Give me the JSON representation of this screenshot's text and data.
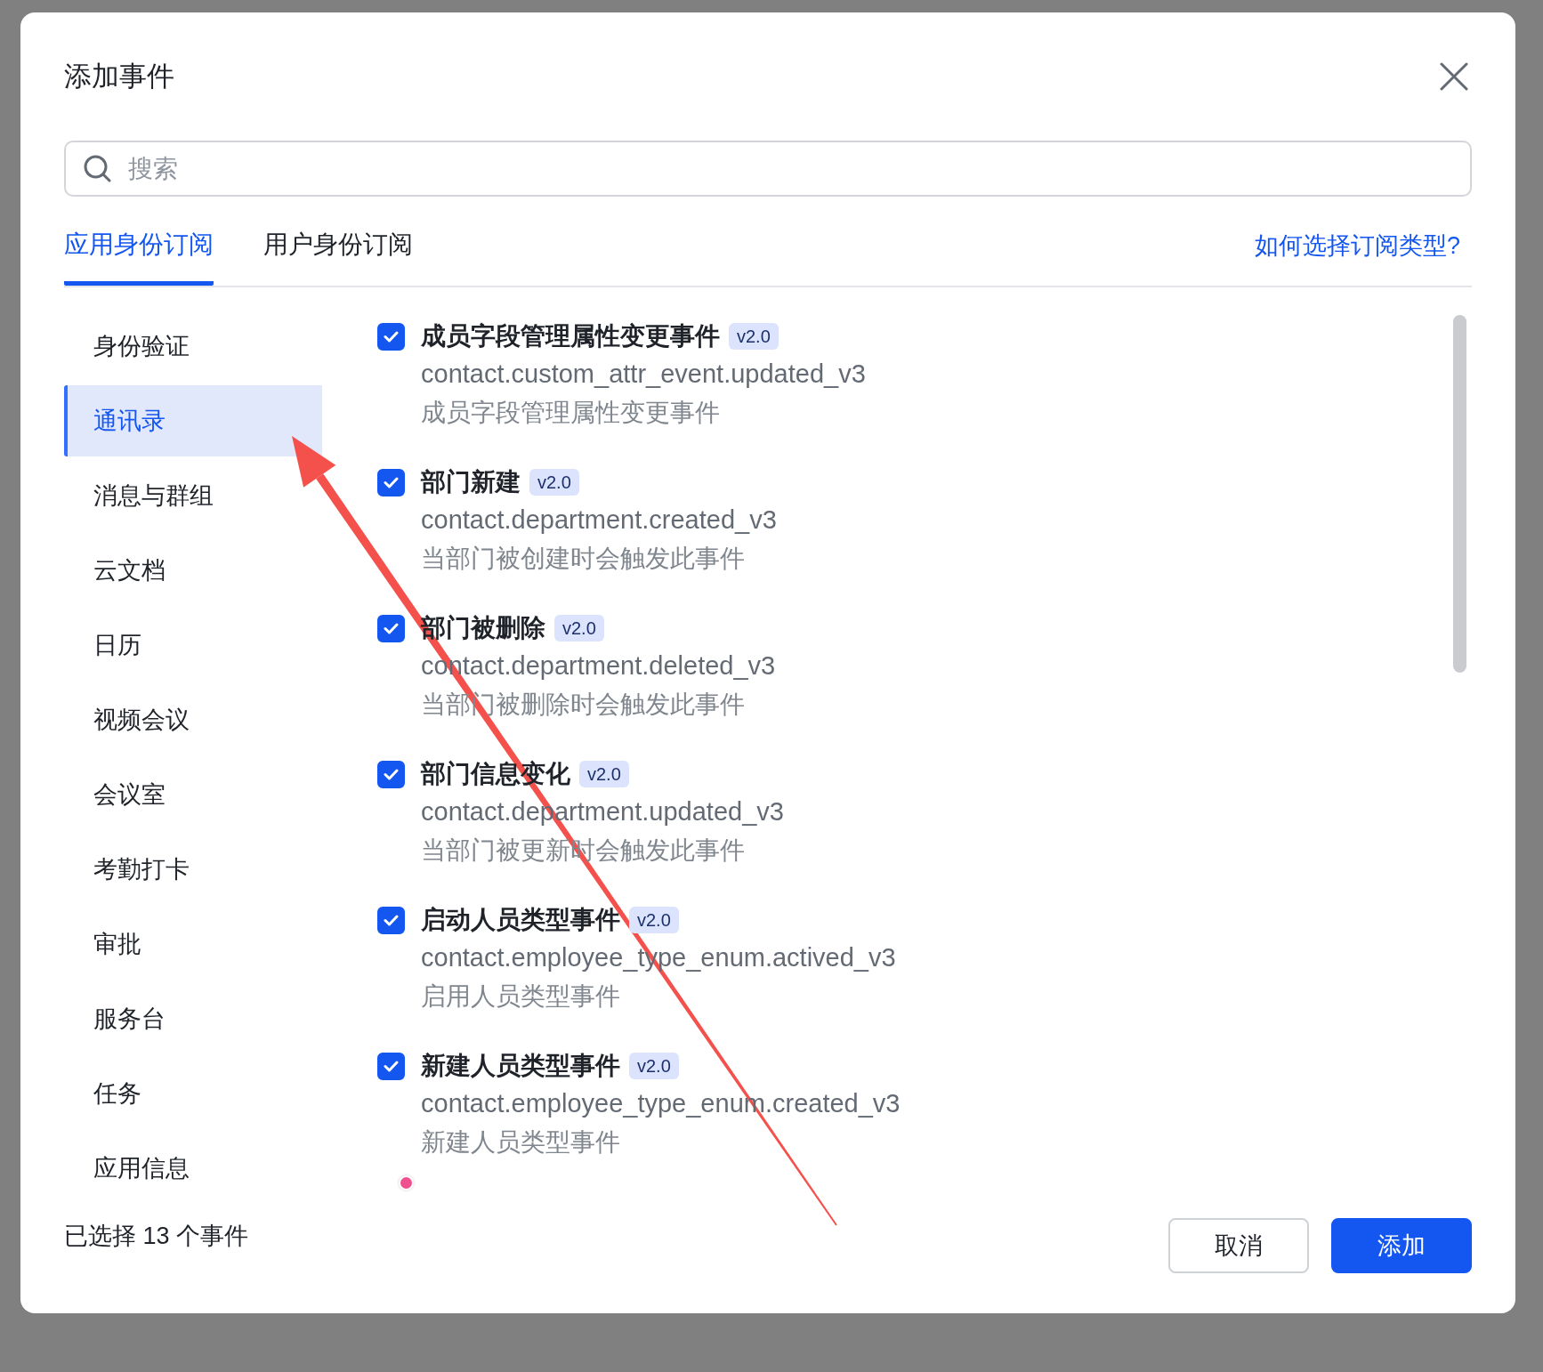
{
  "dialog": {
    "title": "添加事件"
  },
  "search": {
    "placeholder": "搜索"
  },
  "tabs": [
    {
      "label": "应用身份订阅",
      "selected": true
    },
    {
      "label": "用户身份订阅",
      "selected": false
    }
  ],
  "help_link": "如何选择订阅类型?",
  "categories": [
    {
      "label": "身份验证",
      "selected": false
    },
    {
      "label": "通讯录",
      "selected": true
    },
    {
      "label": "消息与群组",
      "selected": false
    },
    {
      "label": "云文档",
      "selected": false
    },
    {
      "label": "日历",
      "selected": false
    },
    {
      "label": "视频会议",
      "selected": false
    },
    {
      "label": "会议室",
      "selected": false
    },
    {
      "label": "考勤打卡",
      "selected": false
    },
    {
      "label": "审批",
      "selected": false
    },
    {
      "label": "服务台",
      "selected": false
    },
    {
      "label": "任务",
      "selected": false
    },
    {
      "label": "应用信息",
      "selected": false
    }
  ],
  "events": [
    {
      "title": "成员字段管理属性变更事件",
      "version": "v2.0",
      "code": "contact.custom_attr_event.updated_v3",
      "description": "成员字段管理属性变更事件",
      "checked": true
    },
    {
      "title": "部门新建",
      "version": "v2.0",
      "code": "contact.department.created_v3",
      "description": "当部门被创建时会触发此事件",
      "checked": true
    },
    {
      "title": "部门被删除",
      "version": "v2.0",
      "code": "contact.department.deleted_v3",
      "description": "当部门被删除时会触发此事件",
      "checked": true
    },
    {
      "title": "部门信息变化",
      "version": "v2.0",
      "code": "contact.department.updated_v3",
      "description": "当部门被更新时会触发此事件",
      "checked": true
    },
    {
      "title": "启动人员类型事件",
      "version": "v2.0",
      "code": "contact.employee_type_enum.actived_v3",
      "description": "启用人员类型事件",
      "checked": true
    },
    {
      "title": "新建人员类型事件",
      "version": "v2.0",
      "code": "contact.employee_type_enum.created_v3",
      "description": "新建人员类型事件",
      "checked": true
    }
  ],
  "footer": {
    "selection_summary": "已选择 13 个事件",
    "buttons": [
      {
        "label": "取消",
        "kind": "secondary"
      },
      {
        "label": "添加",
        "kind": "primary"
      }
    ]
  }
}
